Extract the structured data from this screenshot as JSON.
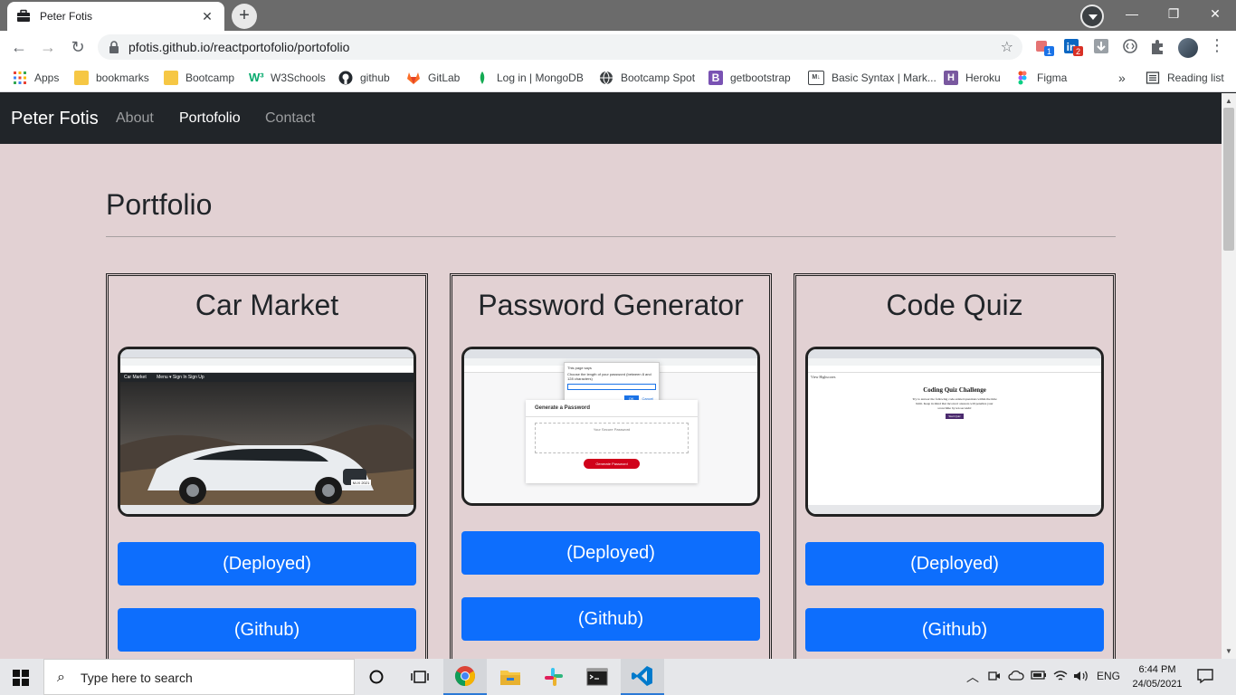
{
  "browser": {
    "tab_title": "Peter Fotis",
    "url": "pfotis.github.io/reactportofolio/portofolio",
    "ext_badge_1": "1",
    "ext_badge_2": "2",
    "bookmarks": [
      {
        "label": "Apps",
        "icon": "apps-grid-icon"
      },
      {
        "label": "bookmarks",
        "icon": "folder-icon"
      },
      {
        "label": "Bootcamp",
        "icon": "folder-icon"
      },
      {
        "label": "W3Schools",
        "icon": "w3schools-icon"
      },
      {
        "label": "github",
        "icon": "github-icon"
      },
      {
        "label": "GitLab",
        "icon": "gitlab-icon"
      },
      {
        "label": "Log in | MongoDB",
        "icon": "mongodb-icon"
      },
      {
        "label": "Bootcamp Spot",
        "icon": "globe-icon"
      },
      {
        "label": "getbootstrap",
        "icon": "bootstrap-icon"
      },
      {
        "label": "Basic Syntax | Mark...",
        "icon": "markdown-icon"
      },
      {
        "label": "Heroku",
        "icon": "heroku-icon"
      },
      {
        "label": "Figma",
        "icon": "figma-icon"
      }
    ],
    "bookmarks_overflow": "»",
    "reading_list": "Reading list"
  },
  "site": {
    "brand": "Peter Fotis",
    "nav": [
      "About",
      "Portofolio",
      "Contact"
    ],
    "active_nav": "Portofolio",
    "page_title": "Portfolio",
    "projects": [
      {
        "title": "Car Market",
        "deployed_label": "(Deployed)",
        "github_label": "(Github)",
        "shot_site": "Car Market",
        "shot_menu": "Menu ▾   Sign In   Sign Up",
        "shot_plate": "M-IX 2021"
      },
      {
        "title": "Password Generator",
        "deployed_label": "(Deployed)",
        "github_label": "(Github)",
        "shot_heading": "Generate a Password",
        "shot_placeholder": "Your Secure Password",
        "shot_button": "Generate Password",
        "shot_dialog_title": "This page says",
        "shot_dialog_text": "Choose the length of your password (between 8 and 128 characters)",
        "shot_dialog_ok": "OK",
        "shot_dialog_cancel": "Cancel"
      },
      {
        "title": "Code Quiz",
        "deployed_label": "(Deployed)",
        "github_label": "(Github)",
        "shot_topleft": "View Highscores",
        "shot_heading": "Coding Quiz Challenge",
        "shot_text": "Try to answer the following code-related questions within the time limit. Keep in mind that incorrect answers will penalize your score/time by ten seconds!",
        "shot_button": "Start Quiz"
      }
    ]
  },
  "taskbar": {
    "search_placeholder": "Type here to search",
    "lang": "ENG",
    "time": "6:44 PM",
    "date": "24/05/2021",
    "apps": [
      "task-view-icon",
      "chrome-icon",
      "file-explorer-icon",
      "slack-icon",
      "terminal-icon",
      "vscode-icon"
    ]
  },
  "colors": {
    "page_bg": "#e2d1d3",
    "navbar_bg": "#212529",
    "button_blue": "#0d6efd"
  }
}
